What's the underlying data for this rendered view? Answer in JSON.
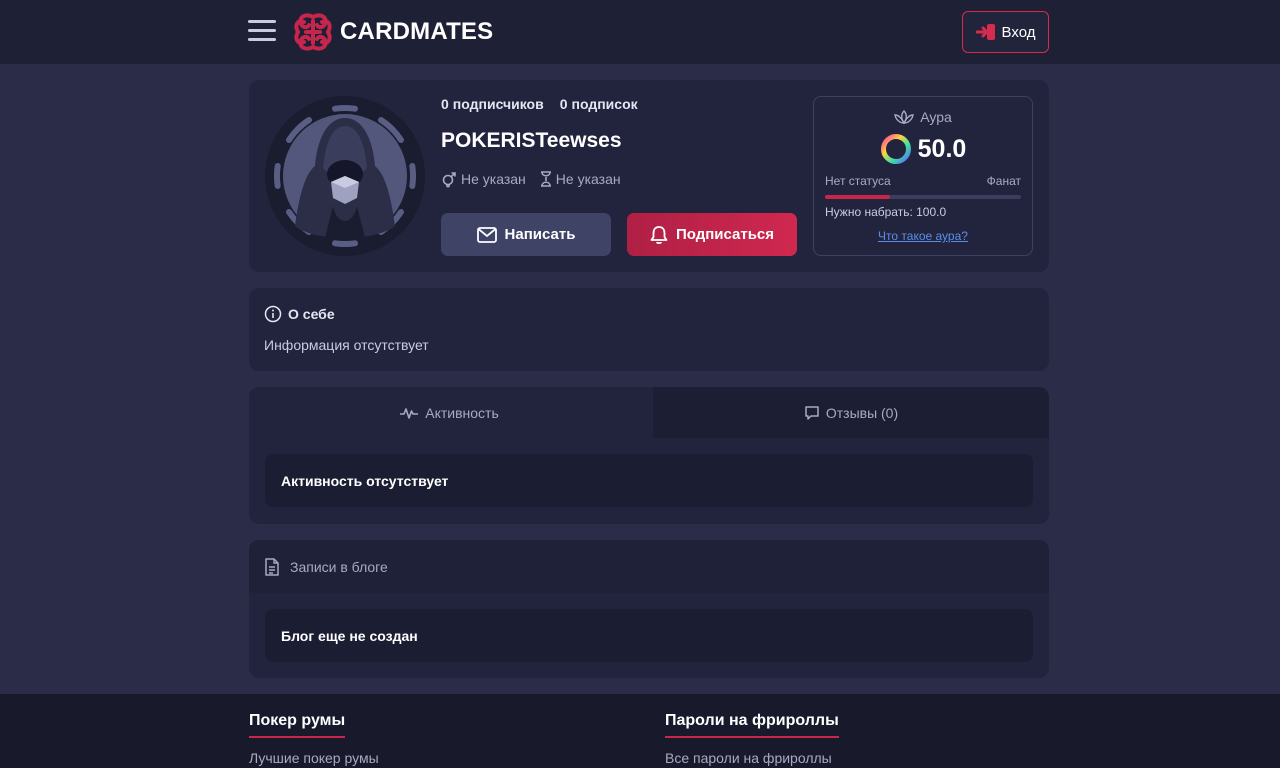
{
  "header": {
    "logo_text": "CARDMATES",
    "login_label": "Вход"
  },
  "profile": {
    "followers_count": "0",
    "followers_label": "подписчиков",
    "following_count": "0",
    "following_label": "подписок",
    "username": "POKERISTeewses",
    "gender": "Не указан",
    "age": "Не указан",
    "write_label": "Написать",
    "subscribe_label": "Подписаться"
  },
  "aura": {
    "title": "Аура",
    "value": "50.0",
    "status_current": "Нет статуса",
    "status_next": "Фанат",
    "progress_fraction": 0.33,
    "need_text": "Нужно набрать: 100.0",
    "link_text": "Что такое аура?"
  },
  "about": {
    "title": "О себе",
    "text": "Информация отсутствует"
  },
  "tabs": {
    "activity_label": "Активность",
    "reviews_label": "Отзывы (0)",
    "activity_empty": "Активность отсутствует"
  },
  "blog": {
    "title": "Записи в блоге",
    "empty": "Блог еще не создан"
  },
  "footer": {
    "col1_title": "Покер румы",
    "col1_link": "Лучшие покер румы",
    "col2_title": "Пароли на фрироллы",
    "col2_link": "Все пароли на фрироллы"
  },
  "colors": {
    "accent": "#c7264c",
    "background": "#2a2c48",
    "card": "#22243e",
    "header": "#1e2036"
  }
}
